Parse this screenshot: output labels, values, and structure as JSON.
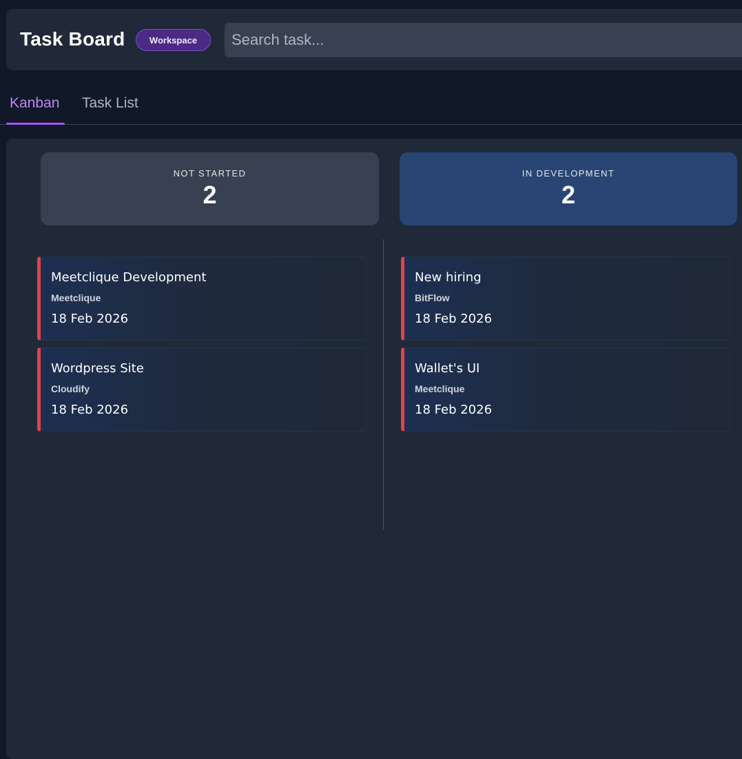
{
  "header": {
    "title": "Task Board",
    "badge": "Workspace",
    "search_placeholder": "Search task..."
  },
  "tabs": [
    {
      "label": "Kanban",
      "active": true
    },
    {
      "label": "Task List",
      "active": false
    }
  ],
  "columns": [
    {
      "label": "NOT STARTED",
      "count": "2",
      "color": "#374151",
      "tasks": [
        {
          "title": "Meetclique Development",
          "company": "Meetclique",
          "date": "18 Feb 2026"
        },
        {
          "title": "Wordpress Site",
          "company": "Cloudify",
          "date": "18 Feb 2026"
        }
      ]
    },
    {
      "label": "IN DEVELOPMENT",
      "count": "2",
      "color": "#284574",
      "tasks": [
        {
          "title": "New hiring",
          "company": "BitFlow",
          "date": "18 Feb 2026"
        },
        {
          "title": "Wallet's UI",
          "company": "Meetclique",
          "date": "18 Feb 2026"
        }
      ]
    }
  ],
  "colors": {
    "accent": "#a855f7",
    "priority_bar": "#e0424b",
    "background": "#111827",
    "panel": "#1f2937"
  }
}
